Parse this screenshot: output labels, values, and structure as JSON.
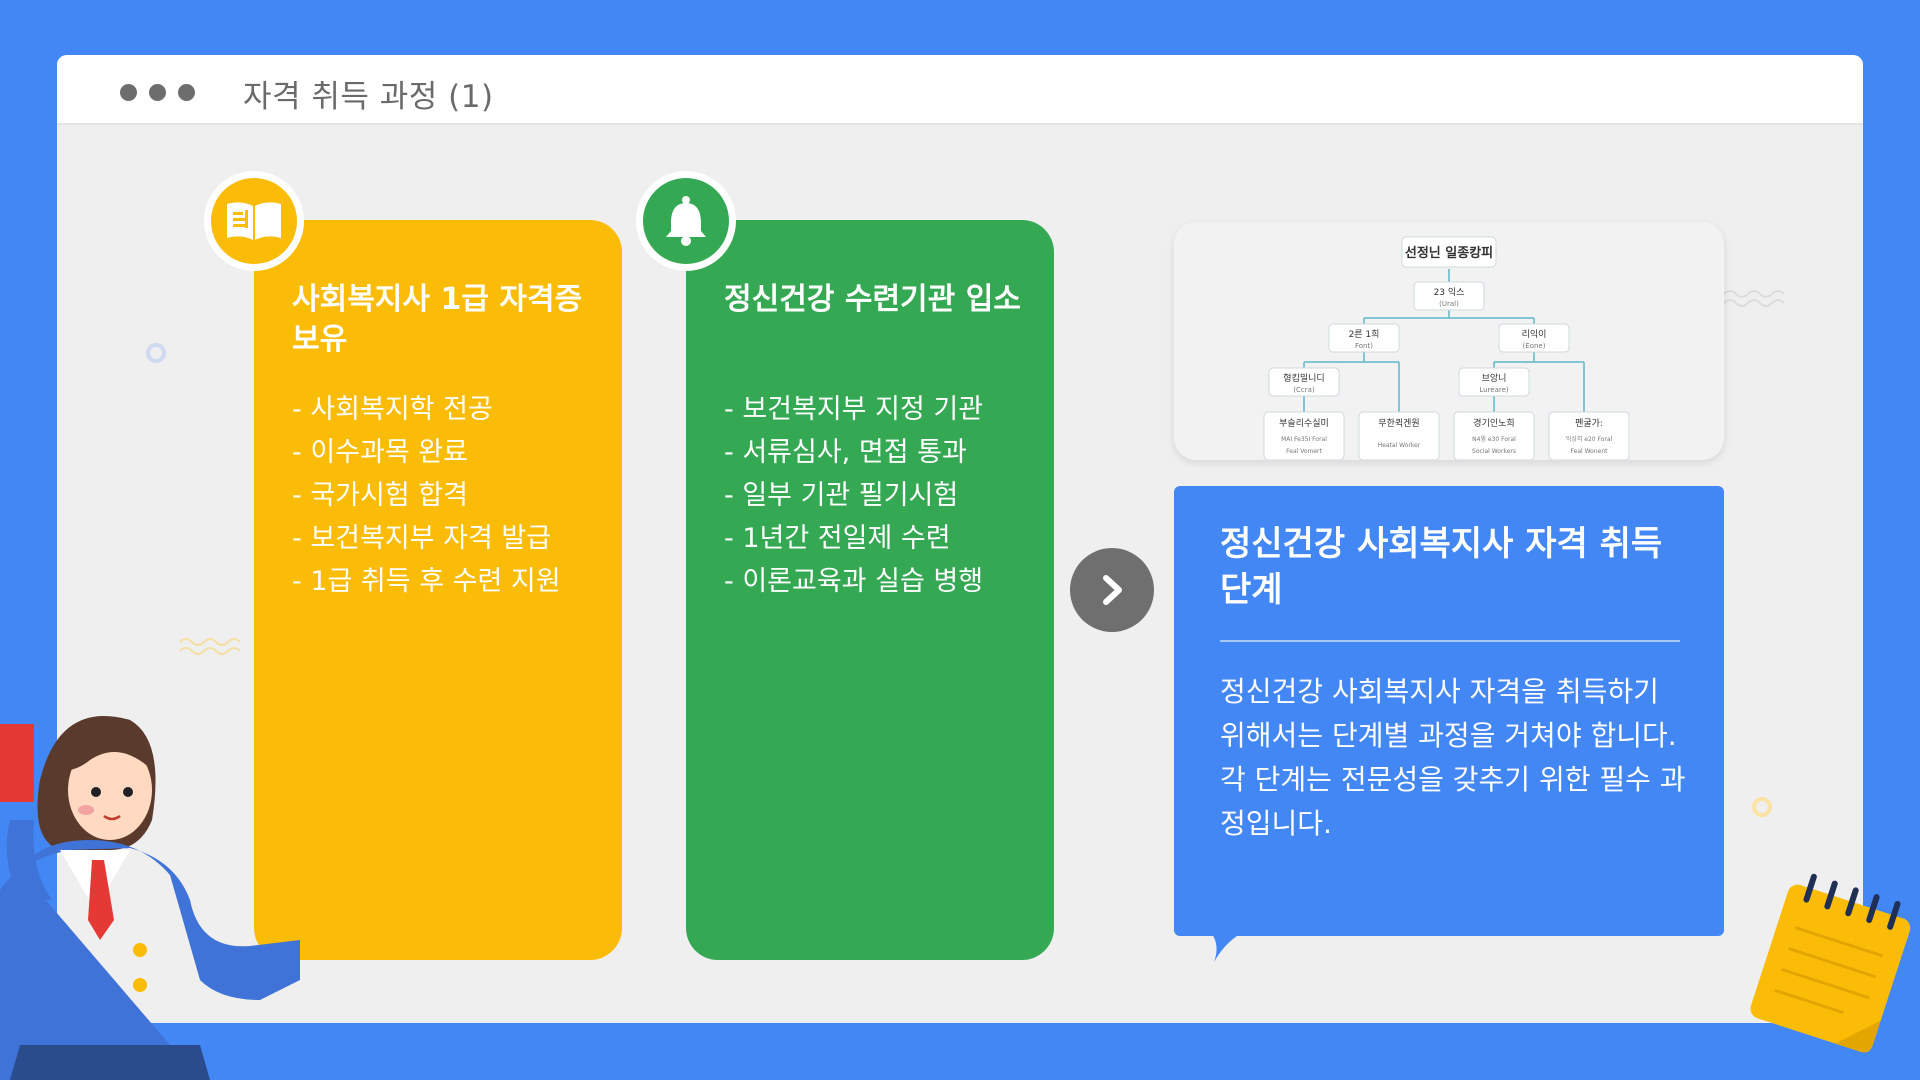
{
  "window": {
    "title": "자격 취득 과정 (1)"
  },
  "cards": [
    {
      "title": "사회복지사 1급 자격증 보유",
      "icon": "book-icon",
      "color": "#fbbc07",
      "items": [
        "- 사회복지학 전공",
        "- 이수과목 완료",
        "- 국가시험 합격",
        "- 보건복지부 자격 발급",
        "- 1급 취득 후 수련 지원"
      ]
    },
    {
      "title": "정신건강 수련기관 입소",
      "icon": "bell-icon",
      "color": "#34a853",
      "items": [
        "- 보건복지부 지정 기관",
        "- 서류심사, 면접 통과",
        "- 일부 기관 필기시험",
        "- 1년간 전일제 수련",
        "- 이론교육과 실습 병행"
      ]
    }
  ],
  "next_button": {
    "icon": "chevron-right-icon"
  },
  "org_chart": {
    "root": "선정닌 일종캉피",
    "level1": {
      "title": "23 익스",
      "sub": "(Ural)"
    },
    "level2": [
      {
        "title": "2른 1희",
        "sub": "Font)"
      },
      {
        "title": "리익이",
        "sub": "(Eone)"
      }
    ],
    "level3": [
      {
        "title": "형킴밀니디",
        "sub": "(Ccra)"
      },
      {
        "title": "브앙니",
        "sub": "Lureare)"
      }
    ],
    "level4": [
      {
        "title": "부슬리수실미",
        "sub1": "MAI Fe35I Foral",
        "sub2": "Feal Vomert"
      },
      {
        "title": "무한퀵겐원",
        "sub1": "Heatal Worker",
        "sub2": ""
      },
      {
        "title": "경기인노희",
        "sub1": "N4윙 e30 Foral",
        "sub2": "Social Workers"
      },
      {
        "title": "펜굴가:",
        "sub1": "익싱히 e20 Foral",
        "sub2": "Feal Wonent"
      }
    ]
  },
  "info": {
    "title": "정신건강 사회복지사 자격 취득 단계",
    "body": "정신건강 사회복지사 자격을 취득하기 위해서는 단계별 과정을 거쳐야 합니다. 각 단계는 전문성을 갖추기 위한 필수 과정입니다."
  },
  "colors": {
    "background": "#4387f4",
    "yellow": "#fbbc07",
    "green": "#34a853",
    "blue": "#4387f4",
    "arrow": "#6f6f6f"
  }
}
